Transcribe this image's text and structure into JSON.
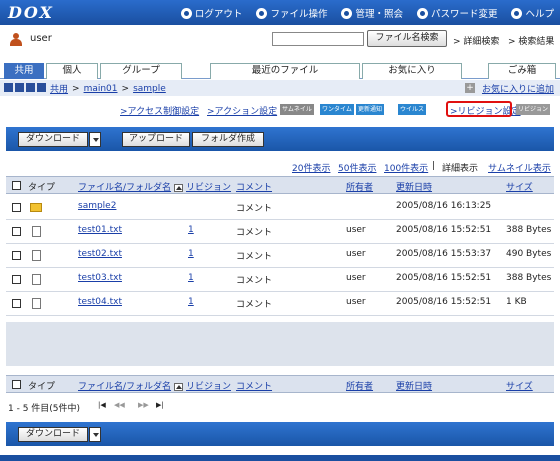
{
  "app": {
    "logo": "DOX"
  },
  "topnav": {
    "logout": "ログアウト",
    "file_ops": "ファイル操作",
    "admin": "管理・照会",
    "password": "パスワード変更",
    "help": "ヘルプ"
  },
  "user": {
    "name": "user"
  },
  "search": {
    "button": "ファイル名検索",
    "detail": "> 詳細検索",
    "results": "> 検索結果"
  },
  "tabs": {
    "shared": "共用",
    "personal": "個人",
    "group": "グループ",
    "recent": "最近のファイル",
    "favorites": "お気に入り",
    "trash": "ごみ箱"
  },
  "breadcrumb": {
    "root": "共用",
    "sep1": ">",
    "folder1": "main01",
    "sep2": ">",
    "folder2": "sample",
    "add_fav": "お気に入りに追加"
  },
  "actions": {
    "access": ">アクセス制御設定",
    "action": ">アクション設定",
    "b1": "サムネイル",
    "b2": "ワンタイム",
    "b3": "更新通知",
    "b4": "ウイルス",
    "revision": ">リビジョン設定",
    "b5": "リビジョン"
  },
  "toolbar": {
    "download": "ダウンロード",
    "upload": "アップロード",
    "mkdir": "フォルダ作成"
  },
  "view": {
    "v20": "20件表示",
    "v50": "50件表示",
    "v100": "100件表示",
    "sep": "|",
    "detail": "詳細表示",
    "thumb": "サムネイル表示"
  },
  "columns": {
    "type": "タイプ",
    "name": "ファイル名/フォルダ名",
    "revision": "リビジョン",
    "comment": "コメント",
    "owner": "所有者",
    "updated": "更新日時",
    "size": "サイズ"
  },
  "rows": [
    {
      "name": "sample2",
      "revision": "",
      "comment": "コメント",
      "owner": "",
      "updated": "2005/08/16 16:13:25",
      "size": ""
    },
    {
      "name": "test01.txt",
      "revision": "1",
      "comment": "コメント",
      "owner": "user",
      "updated": "2005/08/16 15:52:51",
      "size": "388 Bytes"
    },
    {
      "name": "test02.txt",
      "revision": "1",
      "comment": "コメント",
      "owner": "user",
      "updated": "2005/08/16 15:53:37",
      "size": "490 Bytes"
    },
    {
      "name": "test03.txt",
      "revision": "1",
      "comment": "コメント",
      "owner": "user",
      "updated": "2005/08/16 15:52:51",
      "size": "388 Bytes"
    },
    {
      "name": "test04.txt",
      "revision": "1",
      "comment": "コメント",
      "owner": "user",
      "updated": "2005/08/16 15:52:51",
      "size": "1 KB"
    }
  ],
  "pager": {
    "summary": "1 - 5 件目(5件中)",
    "first": "|◀",
    "prev": "◀◀",
    "next": "▶▶",
    "last": "▶|"
  },
  "footer": {
    "download": "ダウンロード"
  }
}
